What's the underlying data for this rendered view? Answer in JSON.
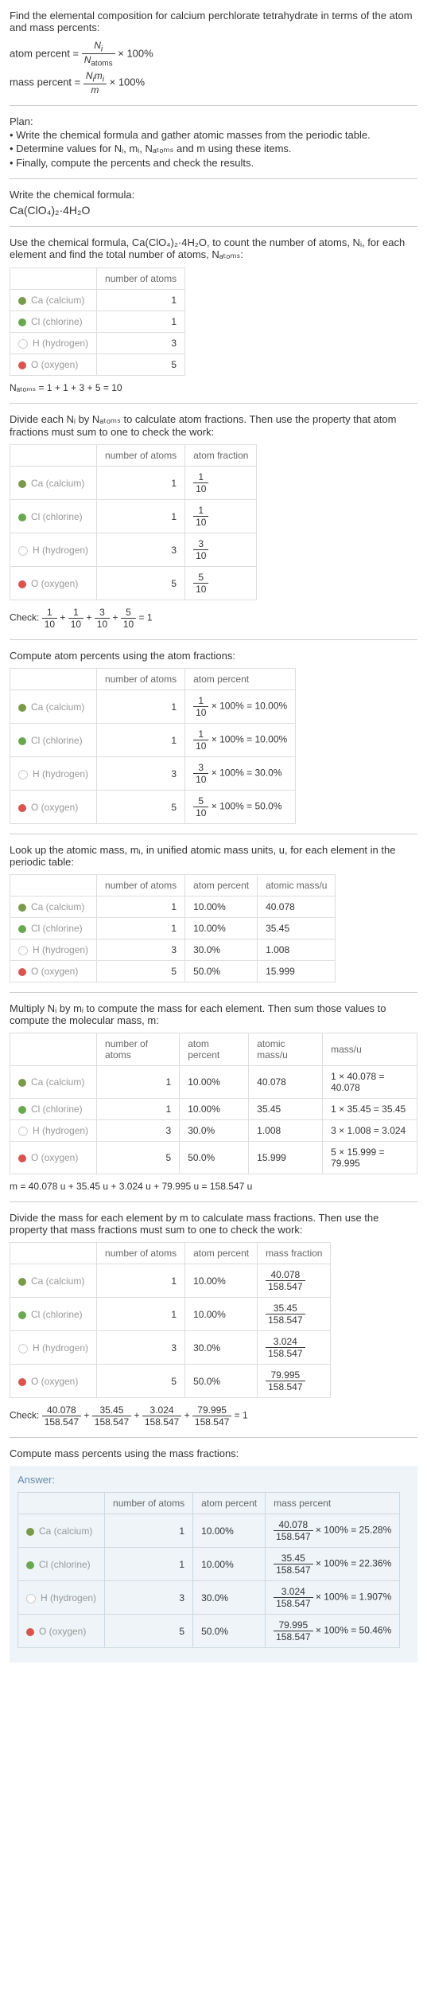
{
  "prompt": "Find the elemental composition for calcium perchlorate tetrahydrate in terms of the atom and mass percents:",
  "atom_percent_label": "atom percent = ",
  "atom_percent_times": " × 100%",
  "mass_percent_label": "mass percent = ",
  "mass_percent_times": " × 100%",
  "frac_Ni": "N",
  "frac_i": "i",
  "frac_Natoms": "N",
  "frac_atoms": "atoms",
  "frac_Nimi": "N",
  "frac_mi_i": "i",
  "frac_m": "m",
  "plan_title": "Plan:",
  "plan_1": "• Write the chemical formula and gather atomic masses from the periodic table.",
  "plan_2": "• Determine values for Nᵢ, mᵢ, Nₐₜₒₘₛ and m using these items.",
  "plan_3": "• Finally, compute the percents and check the results.",
  "step_write": "Write the chemical formula:",
  "chem_formula": "Ca(ClO₄)₂·4H₂O",
  "step_count": "Use the chemical formula, Ca(ClO₄)₂·4H₂O, to count the number of atoms, Nᵢ, for each element and find the total number of atoms, Nₐₜₒₘₛ:",
  "col_number": "number of atoms",
  "col_atom_fraction": "atom fraction",
  "col_atom_percent": "atom percent",
  "col_atomic_mass": "atomic mass/u",
  "col_mass": "mass/u",
  "col_mass_fraction": "mass fraction",
  "col_mass_percent": "mass percent",
  "elements": {
    "ca": {
      "label": "Ca (calcium)",
      "n": "1",
      "frac": {
        "num": "1",
        "den": "10"
      },
      "ap": "10.00%",
      "am": "40.078",
      "mass": "1 × 40.078 = 40.078",
      "mfnum": "40.078",
      "mfden": "158.547",
      "mp": "40.078/158.547 × 100% = 25.28%"
    },
    "cl": {
      "label": "Cl (chlorine)",
      "n": "1",
      "frac": {
        "num": "1",
        "den": "10"
      },
      "ap": "10.00%",
      "am": "35.45",
      "mass": "1 × 35.45 = 35.45",
      "mfnum": "35.45",
      "mfden": "158.547",
      "mp": "35.45/158.547 × 100% = 22.36%"
    },
    "h": {
      "label": "H (hydrogen)",
      "n": "3",
      "frac": {
        "num": "3",
        "den": "10"
      },
      "ap": "30.0%",
      "am": "1.008",
      "mass": "3 × 1.008 = 3.024",
      "mfnum": "3.024",
      "mfden": "158.547",
      "mp": "3.024/158.547 × 100% = 1.907%"
    },
    "o": {
      "label": "O (oxygen)",
      "n": "5",
      "frac": {
        "num": "5",
        "den": "10"
      },
      "ap": "50.0%",
      "am": "15.999",
      "mass": "5 × 15.999 = 79.995",
      "mfnum": "79.995",
      "mfden": "158.547",
      "mp": "79.995/158.547 × 100% = 50.46%"
    }
  },
  "natoms_line": "Nₐₜₒₘₛ = 1 + 1 + 3 + 5 = 10",
  "step_divide_frac": "Divide each Nᵢ by Nₐₜₒₘₛ to calculate atom fractions. Then use the property that atom fractions must sum to one to check the work:",
  "check_frac": "Check: ",
  "check_frac_eq": " = 1",
  "step_atom_percent": "Compute atom percents using the atom fractions:",
  "ap_ca": "1/10 × 100% = 10.00%",
  "ap_cl": "1/10 × 100% = 10.00%",
  "ap_h": "3/10 × 100% = 30.0%",
  "ap_o": "5/10 × 100% = 50.0%",
  "step_lookup": "Look up the atomic mass, mᵢ, in unified atomic mass units, u, for each element in the periodic table:",
  "step_multiply": "Multiply Nᵢ by mᵢ to compute the mass for each element. Then sum those values to compute the molecular mass, m:",
  "m_total": "m = 40.078 u + 35.45 u + 3.024 u + 79.995 u = 158.547 u",
  "step_mass_frac": "Divide the mass for each element by m to calculate mass fractions. Then use the property that mass fractions must sum to one to check the work:",
  "check_mass": "Check: ",
  "check_mass_eq": " = 1",
  "step_mass_percent": "Compute mass percents using the mass fractions:",
  "answer_label": "Answer:",
  "plus": " + ",
  "frac_parts": {
    "f1n": "1",
    "f1d": "10",
    "f2n": "1",
    "f2d": "10",
    "f3n": "3",
    "f3d": "10",
    "f4n": "5",
    "f4d": "10"
  },
  "mass_frac_parts": {
    "m1n": "40.078",
    "m1d": "158.547",
    "m2n": "35.45",
    "m2d": "158.547",
    "m3n": "3.024",
    "m3d": "158.547",
    "m4n": "79.995",
    "m4d": "158.547"
  },
  "ap_frac": {
    "ca_n": "1",
    "ca_d": "10",
    "ca_r": " × 100% = 10.00%",
    "cl_n": "1",
    "cl_d": "10",
    "cl_r": " × 100% = 10.00%",
    "h_n": "3",
    "h_d": "10",
    "h_r": " × 100% = 30.0%",
    "o_n": "5",
    "o_d": "10",
    "o_r": " × 100% = 50.0%"
  },
  "mp_frac": {
    "ca_n": "40.078",
    "ca_d": "158.547",
    "ca_r": " × 100% = 25.28%",
    "cl_n": "35.45",
    "cl_d": "158.547",
    "cl_r": " × 100% = 22.36%",
    "h_n": "3.024",
    "h_d": "158.547",
    "h_r": " × 100% = 1.907%",
    "o_n": "79.995",
    "o_d": "158.547",
    "o_r": " × 100% = 50.46%"
  }
}
